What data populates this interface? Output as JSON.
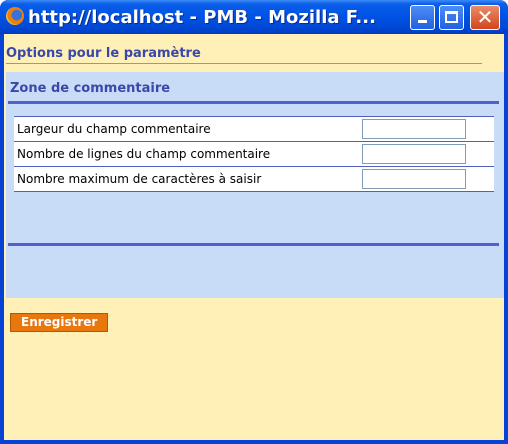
{
  "window": {
    "title": "http://localhost - PMB - Mozilla F...",
    "close_glyph": "✕"
  },
  "page": {
    "title": "Options pour le paramètre",
    "section_title": "Zone de commentaire",
    "fields": [
      {
        "label": "Largeur du champ commentaire",
        "value": ""
      },
      {
        "label": "Nombre de lignes du champ commentaire",
        "value": ""
      },
      {
        "label": "Nombre maximum de caractères à saisir",
        "value": ""
      }
    ],
    "save_label": "Enregistrer"
  },
  "icons": {
    "app": "firefox-icon",
    "minimize": "minimize-icon",
    "maximize": "maximize-icon",
    "close": "close-icon"
  },
  "colors": {
    "title_text": "#3a48a8",
    "panel_bg": "#c8dcf8",
    "page_bg": "#fff0b8",
    "save_button": "#e8770e"
  }
}
